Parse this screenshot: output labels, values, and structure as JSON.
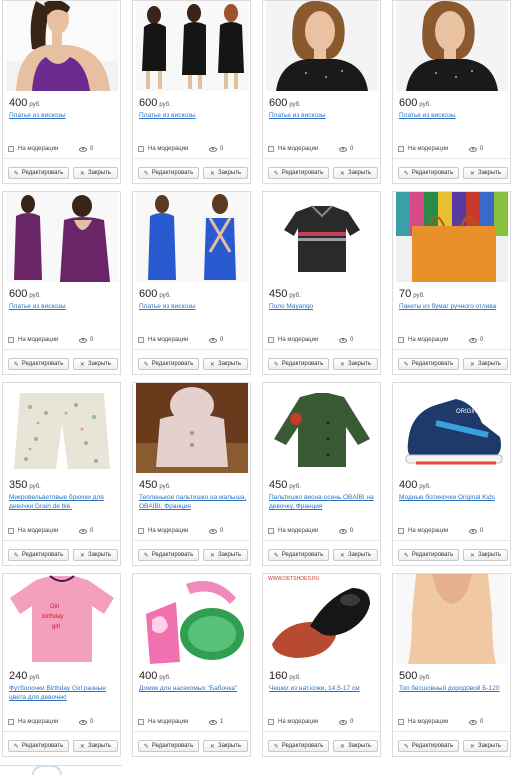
{
  "status_label": "На модерации",
  "edit_label": "Редактировать",
  "close_label": "Закрыть",
  "currency": "руб.",
  "cards": [
    {
      "price": "400",
      "title": "Платье из вискозы",
      "views": "0"
    },
    {
      "price": "600",
      "title": "Платье из вискозы",
      "views": "0"
    },
    {
      "price": "600",
      "title": "Платье из вискозы",
      "views": "0"
    },
    {
      "price": "600",
      "title": "Платье из вискозы",
      "views": "0"
    },
    {
      "price": "600",
      "title": "Платье из вискозы",
      "views": "0"
    },
    {
      "price": "600",
      "title": "Платье из вискозы",
      "views": "0"
    },
    {
      "price": "450",
      "title": "Поло Mayango",
      "views": "0"
    },
    {
      "price": "70",
      "title": "Пакеты из бумаг ручного отлива",
      "views": "0"
    },
    {
      "price": "350",
      "title": "Микровельветовые брючки для девочки Grain de blé.",
      "views": "0"
    },
    {
      "price": "450",
      "title": "Тепленькое пальтишко на малыша, OBAÏBI, Франция",
      "views": "0"
    },
    {
      "price": "450",
      "title": "Пальтишко весна-осень OBAÏBI на девочку, Франция",
      "views": "0"
    },
    {
      "price": "400",
      "title": "Модные ботиночки Original Kids",
      "views": "0"
    },
    {
      "price": "240",
      "title": "Футболочки Birthday Girl разные цвета для девочек!",
      "views": "0"
    },
    {
      "price": "400",
      "title": "Домик для насекомых \"Бабочка\"",
      "views": "1"
    },
    {
      "price": "160",
      "title": "Чешки из нат.кожи, 14,5-17 см",
      "views": "0"
    },
    {
      "price": "500",
      "title": "Топ бесшовный дородовой Б-120",
      "views": "0"
    }
  ],
  "image_texts": {
    "shirt_print_line1": "Girl",
    "shirt_print_line2": "birthday",
    "shirt_print_line3": "girl",
    "shoe_brand": "ORIGINAL",
    "shoe_site": "WWW.DETSHOES.RU"
  },
  "colors": {
    "link": "#2a73c9",
    "border": "#dcdcdc"
  }
}
